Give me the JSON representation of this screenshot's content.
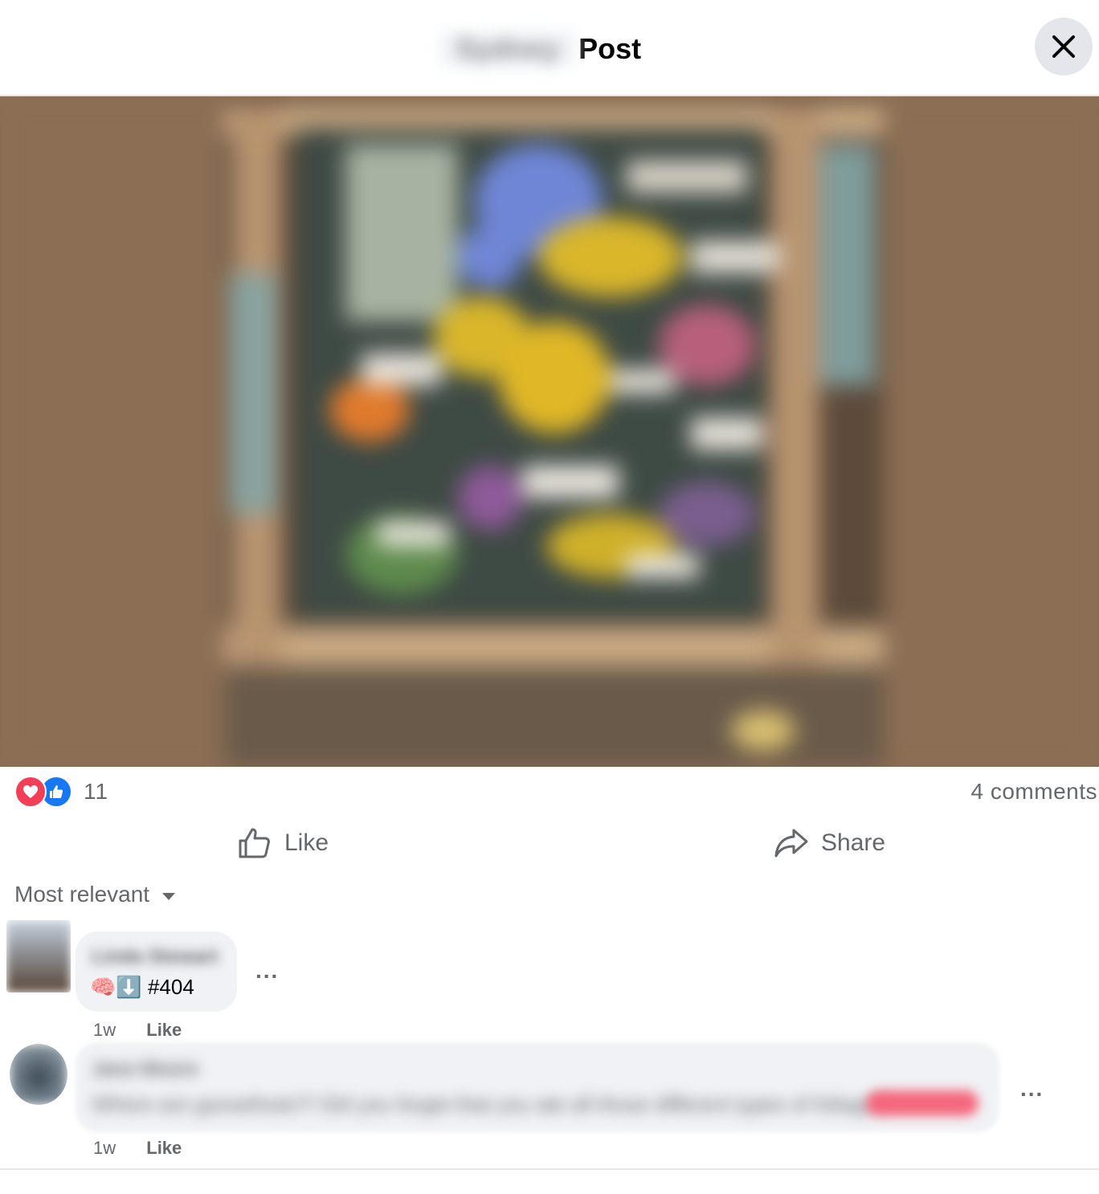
{
  "header": {
    "title_name": "Sydney",
    "title_suffix": "Post",
    "close_label": "Close"
  },
  "post": {
    "reaction_count": "11",
    "comments_count": "4 comments",
    "like_label": "Like",
    "share_label": "Share"
  },
  "comments": {
    "sort_label": "Most relevant",
    "items": [
      {
        "author": "Linda Stewart",
        "text": "🧠⬇️ #404",
        "time": "1w",
        "like_label": "Like",
        "more": "..."
      },
      {
        "author": "Jane Moore",
        "text": "Where are goosefoots?! Did you forget that you ate all those different types of foliage?",
        "time": "1w",
        "like_label": "Like",
        "more": "..."
      }
    ]
  },
  "colors": {
    "accent": "#1877f2",
    "love": "#f33e58",
    "secondary_text": "#65676b",
    "bubble": "#f0f2f5",
    "media_bg": "#8b6e54"
  }
}
